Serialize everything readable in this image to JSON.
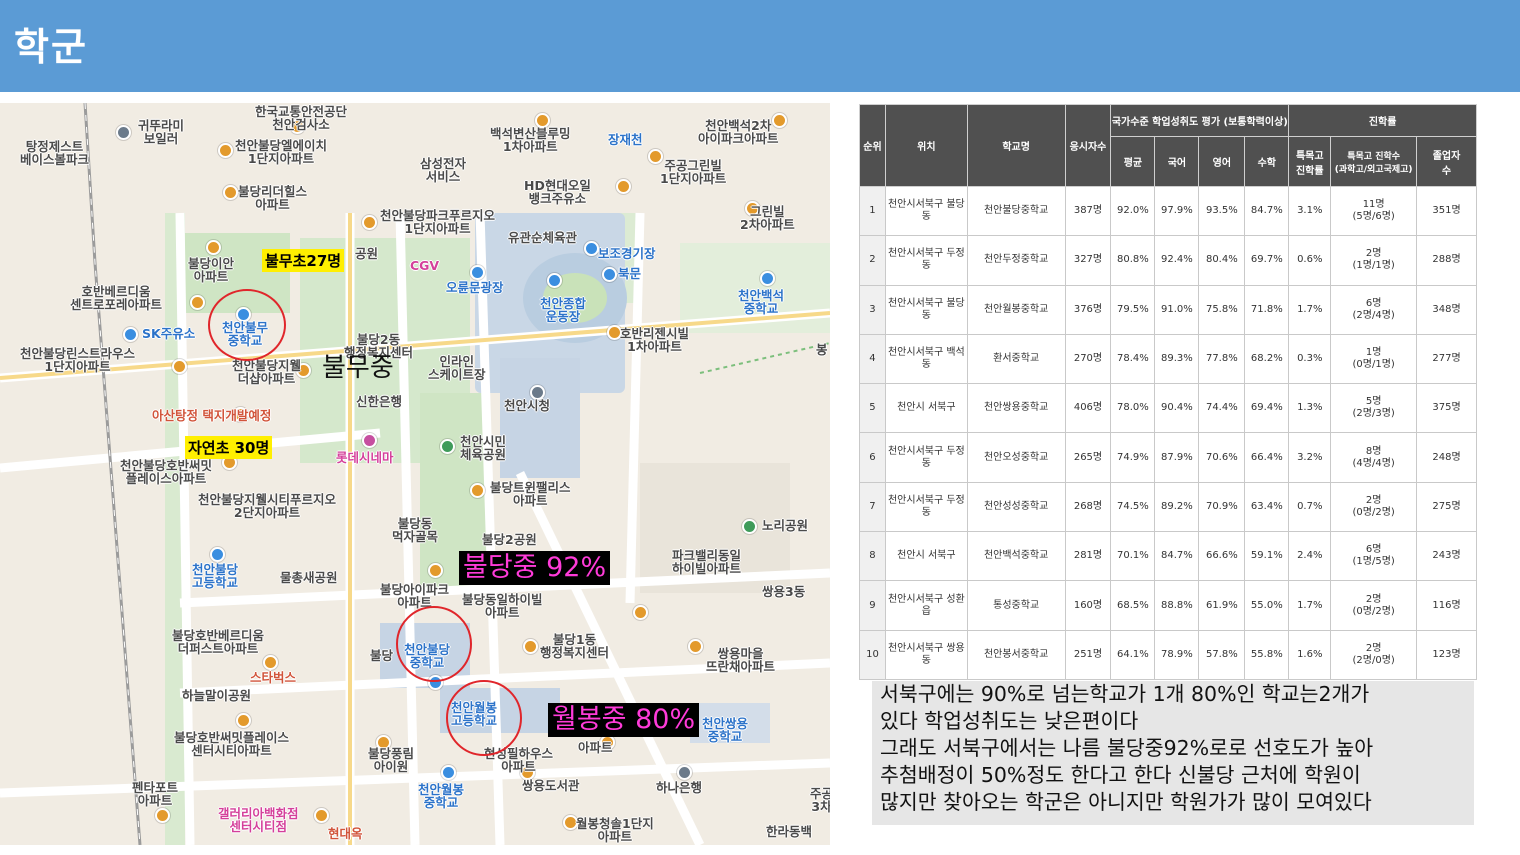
{
  "header": {
    "title": "학군"
  },
  "map": {
    "places": [
      {
        "id": "p1",
        "text": "한국교통안전공단\n천안검사소",
        "cls": ""
      },
      {
        "id": "p2",
        "text": "귀뚜라미\n보일러",
        "cls": ""
      },
      {
        "id": "p3",
        "text": "탕정제스트\n베이스볼파크",
        "cls": ""
      },
      {
        "id": "p4",
        "text": "천안불당엘에이치\n1단지아파트",
        "cls": ""
      },
      {
        "id": "p5",
        "text": "삼성전자\n서비스",
        "cls": ""
      },
      {
        "id": "p6",
        "text": "백석변산블루밍\n1차아파트",
        "cls": ""
      },
      {
        "id": "p7",
        "text": "장재천",
        "cls": "blue"
      },
      {
        "id": "p8",
        "text": "천안백석2차\n아이파크아파트",
        "cls": ""
      },
      {
        "id": "p9",
        "text": "주공그린빌\n1단지아파트",
        "cls": ""
      },
      {
        "id": "p10",
        "text": "HD현대오일\n뱅크주유소",
        "cls": ""
      },
      {
        "id": "p11",
        "text": "불당리더힐스\n아파트",
        "cls": ""
      },
      {
        "id": "p12",
        "text": "천안불당파크푸르지오\n1단지아파트",
        "cls": ""
      },
      {
        "id": "p13",
        "text": "그린빌\n2차아파트",
        "cls": ""
      },
      {
        "id": "p14",
        "text": "유관순체육관",
        "cls": ""
      },
      {
        "id": "p15",
        "text": "보조경기장",
        "cls": "blue"
      },
      {
        "id": "p16",
        "text": "북문",
        "cls": "blue"
      },
      {
        "id": "p17",
        "text": "불당이안\n아파트",
        "cls": ""
      },
      {
        "id": "p18",
        "text": "공원",
        "cls": ""
      },
      {
        "id": "p19",
        "text": "CGV",
        "cls": "pink"
      },
      {
        "id": "p20",
        "text": "오륜문광장",
        "cls": "blue"
      },
      {
        "id": "p21",
        "text": "천안종합\n운동장",
        "cls": "blue"
      },
      {
        "id": "p22",
        "text": "천안백석\n중학교",
        "cls": "blue"
      },
      {
        "id": "p23",
        "text": "호반베르디움\n센트로포레아파트",
        "cls": ""
      },
      {
        "id": "p24",
        "text": "SK주유소",
        "cls": "blue"
      },
      {
        "id": "p25",
        "text": "천안불무\n중학교",
        "cls": "blue"
      },
      {
        "id": "p26",
        "text": "불당2동\n행정복지센터",
        "cls": ""
      },
      {
        "id": "p27",
        "text": "호반리젠시빌\n1차아파트",
        "cls": ""
      },
      {
        "id": "p28",
        "text": "천안불당린스트라우스\n1단지아파트",
        "cls": ""
      },
      {
        "id": "p29",
        "text": "천안불당지웰\n더샵아파트",
        "cls": ""
      },
      {
        "id": "p30",
        "text": "인라인\n스케이트장",
        "cls": ""
      },
      {
        "id": "p31",
        "text": "신한은행",
        "cls": ""
      },
      {
        "id": "p32",
        "text": "천안시청",
        "cls": ""
      },
      {
        "id": "p33",
        "text": "아산탕정 택지개발예정",
        "cls": "red"
      },
      {
        "id": "p34",
        "text": "천안시민\n체육공원",
        "cls": ""
      },
      {
        "id": "p35",
        "text": "롯데시네마",
        "cls": "pink"
      },
      {
        "id": "p36",
        "text": "천안불당호반써밋\n플레이스아파트",
        "cls": ""
      },
      {
        "id": "p37",
        "text": "불당트윈팰리스\n아파트",
        "cls": ""
      },
      {
        "id": "p38",
        "text": "천안불당지웰시티푸르지오\n2단지아파트",
        "cls": ""
      },
      {
        "id": "p39",
        "text": "불당동\n먹자골목",
        "cls": ""
      },
      {
        "id": "p40",
        "text": "불당2공원",
        "cls": ""
      },
      {
        "id": "p41",
        "text": "노리공원",
        "cls": ""
      },
      {
        "id": "p42",
        "text": "천안불당\n고등학교",
        "cls": "blue"
      },
      {
        "id": "p43",
        "text": "물총새공원",
        "cls": ""
      },
      {
        "id": "p44",
        "text": "파크밸리동일\n하이빌아파트",
        "cls": ""
      },
      {
        "id": "p45",
        "text": "불당아이파크\n아파트",
        "cls": ""
      },
      {
        "id": "p46",
        "text": "불당동일하이빌\n아파트",
        "cls": ""
      },
      {
        "id": "p47",
        "text": "쌍용3동",
        "cls": ""
      },
      {
        "id": "p48",
        "text": "불당호반베르디움\n더퍼스트아파트",
        "cls": ""
      },
      {
        "id": "p49",
        "text": "불당",
        "cls": ""
      },
      {
        "id": "p50",
        "text": "천안불당\n중학교",
        "cls": "blue"
      },
      {
        "id": "p51",
        "text": "불당1동\n행정복지센터",
        "cls": ""
      },
      {
        "id": "p52",
        "text": "쌍용마을\n뜨란채아파트",
        "cls": ""
      },
      {
        "id": "p53",
        "text": "스타벅스",
        "cls": "red"
      },
      {
        "id": "p54",
        "text": "하늘말이공원",
        "cls": ""
      },
      {
        "id": "p55",
        "text": "천안월봉\n고등학교",
        "cls": "blue"
      },
      {
        "id": "p56",
        "text": "천안쌍용\n중학교",
        "cls": "blue"
      },
      {
        "id": "p57",
        "text": "불당호반써밋플레이스\n센터시티아파트",
        "cls": ""
      },
      {
        "id": "p58",
        "text": "불당풍림\n아이원",
        "cls": ""
      },
      {
        "id": "p59",
        "text": "현성필하우스\n아파트",
        "cls": ""
      },
      {
        "id": "p60",
        "text": "아파트",
        "cls": ""
      },
      {
        "id": "p61",
        "text": "천안월봉\n중학교",
        "cls": "blue"
      },
      {
        "id": "p62",
        "text": "쌍용도서관",
        "cls": ""
      },
      {
        "id": "p63",
        "text": "하나은행",
        "cls": ""
      },
      {
        "id": "p64",
        "text": "펜타포트\n아파트",
        "cls": ""
      },
      {
        "id": "p65",
        "text": "갤러리아백화점\n센터시티점",
        "cls": "pink"
      },
      {
        "id": "p66",
        "text": "현대옥",
        "cls": "red"
      },
      {
        "id": "p67",
        "text": "월봉청솔1단지\n아파트",
        "cls": ""
      },
      {
        "id": "p68",
        "text": "한라동백",
        "cls": ""
      },
      {
        "id": "p69",
        "text": "주공\n3차",
        "cls": ""
      },
      {
        "id": "p70",
        "text": "봉",
        "cls": ""
      }
    ],
    "annotations": {
      "bulmu_elem": "불무초27명",
      "jayeon_elem": "자연초 30명",
      "bulmu_mid": "불무중",
      "buldang_mid": "불당중 92%",
      "wolbong_mid": "월봉중 80%"
    }
  },
  "table": {
    "group_headers": {
      "achievement": "국가수준 학업성취도 평가 (보통학력이상)",
      "advancement": "진학률"
    },
    "columns": {
      "rank": "순위",
      "location": "위치",
      "school": "학교명",
      "examinees": "응시자수",
      "avg": "평균",
      "korean": "국어",
      "english": "영어",
      "math": "수학",
      "special_rate": "특목고\n진학률",
      "special_count": "특목고 진학수\n(과학고/외고국제고)",
      "graduates": "졸업자\n수"
    },
    "rows": [
      {
        "rank": "1",
        "location": "천안시서북구 불당동",
        "school": "천안불당중학교",
        "examinees": "387명",
        "avg": "92.0%",
        "korean": "97.9%",
        "english": "93.5%",
        "math": "84.7%",
        "special_rate": "3.1%",
        "special_count": "11명\n(5명/6명)",
        "graduates": "351명"
      },
      {
        "rank": "2",
        "location": "천안시서북구 두정동",
        "school": "천안두정중학교",
        "examinees": "327명",
        "avg": "80.8%",
        "korean": "92.4%",
        "english": "80.4%",
        "math": "69.7%",
        "special_rate": "0.6%",
        "special_count": "2명\n(1명/1명)",
        "graduates": "288명"
      },
      {
        "rank": "3",
        "location": "천안시서북구 불당동",
        "school": "천안월봉중학교",
        "examinees": "376명",
        "avg": "79.5%",
        "korean": "91.0%",
        "english": "75.8%",
        "math": "71.8%",
        "special_rate": "1.7%",
        "special_count": "6명\n(2명/4명)",
        "graduates": "348명"
      },
      {
        "rank": "4",
        "location": "천안시서북구 백석동",
        "school": "환서중학교",
        "examinees": "270명",
        "avg": "78.4%",
        "korean": "89.3%",
        "english": "77.8%",
        "math": "68.2%",
        "special_rate": "0.3%",
        "special_count": "1명\n(0명/1명)",
        "graduates": "277명"
      },
      {
        "rank": "5",
        "location": "천안시 서북구",
        "school": "천안쌍용중학교",
        "examinees": "406명",
        "avg": "78.0%",
        "korean": "90.4%",
        "english": "74.4%",
        "math": "69.4%",
        "special_rate": "1.3%",
        "special_count": "5명\n(2명/3명)",
        "graduates": "375명"
      },
      {
        "rank": "6",
        "location": "천안시서북구 두정동",
        "school": "천안오성중학교",
        "examinees": "265명",
        "avg": "74.9%",
        "korean": "87.9%",
        "english": "70.6%",
        "math": "66.4%",
        "special_rate": "3.2%",
        "special_count": "8명\n(4명/4명)",
        "graduates": "248명"
      },
      {
        "rank": "7",
        "location": "천안시서북구 두정동",
        "school": "천안성성중학교",
        "examinees": "268명",
        "avg": "74.5%",
        "korean": "89.2%",
        "english": "70.9%",
        "math": "63.4%",
        "special_rate": "0.7%",
        "special_count": "2명\n(0명/2명)",
        "graduates": "275명"
      },
      {
        "rank": "8",
        "location": "천안시 서북구",
        "school": "천안백석중학교",
        "examinees": "281명",
        "avg": "70.1%",
        "korean": "84.7%",
        "english": "66.6%",
        "math": "59.1%",
        "special_rate": "2.4%",
        "special_count": "6명\n(1명/5명)",
        "graduates": "243명"
      },
      {
        "rank": "9",
        "location": "천안시서북구 성환읍",
        "school": "통성중학교",
        "examinees": "160명",
        "avg": "68.5%",
        "korean": "88.8%",
        "english": "61.9%",
        "math": "55.0%",
        "special_rate": "1.7%",
        "special_count": "2명\n(0명/2명)",
        "graduates": "116명"
      },
      {
        "rank": "10",
        "location": "천안시서북구 쌍용동",
        "school": "천안봉서중학교",
        "examinees": "251명",
        "avg": "64.1%",
        "korean": "78.9%",
        "english": "57.8%",
        "math": "55.8%",
        "special_rate": "1.6%",
        "special_count": "2명\n(2명/0명)",
        "graduates": "123명"
      }
    ]
  },
  "note": {
    "lines": [
      "서북구에는 90%로 넘는학교가 1개 80%인 학교는2개가",
      "있다 학업성취도는 낮은편이다",
      "그래도 서북구에서는 나름 불당중92%로로 선호도가 높아",
      "추첨배정이 50%정도 한다고 한다 신불당 근처에 학원이",
      "많지만 찾아오는 학군은 아니지만 학원가가 많이 모여있다"
    ]
  }
}
